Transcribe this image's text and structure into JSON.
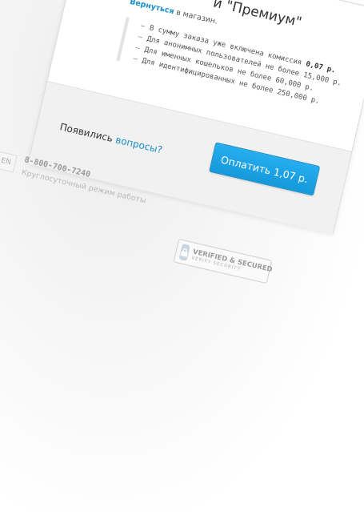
{
  "header": {
    "title": "и \"Премиум\"",
    "back_link": "Вернуться",
    "back_suffix": " в магазин."
  },
  "info": {
    "items": [
      {
        "text": "В сумму заказа уже включена комиссия ",
        "bold": "0,07 р."
      },
      {
        "text": "Для анонимных пользователей не более 15,000 р.",
        "bold": ""
      },
      {
        "text": "Для именных кошельков не более 60,000 р.",
        "bold": ""
      },
      {
        "text": "Для идентифицированных не более 250,000 р.",
        "bold": ""
      }
    ]
  },
  "footer": {
    "questions_prefix": "Появились ",
    "questions_link": "вопросы?",
    "pay_button": "Оплатить 1,07 р."
  },
  "contact": {
    "language": "EN",
    "phone": "8-800-700-7240",
    "hours": "Круглосуточный режим работы"
  },
  "badge": {
    "main": "VERIFIED & SECURED",
    "sub": "VERIFY SECURITY"
  },
  "colors": {
    "accent": "#1a8fc8",
    "button": "#1ea3e6"
  }
}
